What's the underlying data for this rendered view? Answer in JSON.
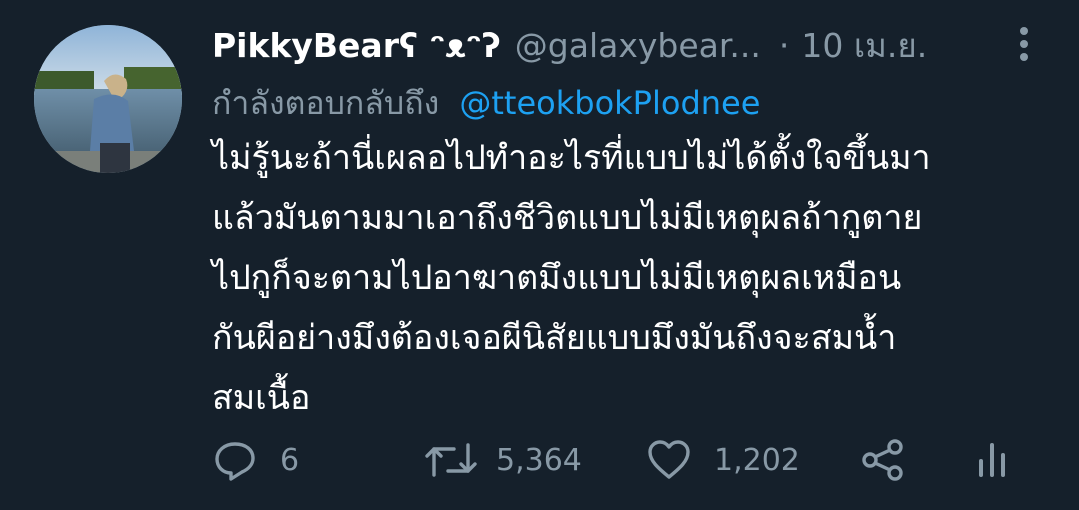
{
  "tweet": {
    "display_name": "PikkyBearʕ ᵔᴥᵔʔ",
    "handle": "@galaxybear...",
    "separator": "·",
    "time": "10 เม.ย.",
    "reply_prefix": "กำลังตอบกลับถึง",
    "reply_mention": "@tteokbokPlodnee",
    "body_lines": [
      "ไม่รู้นะถ้านี่เผลอไปทำอะไรที่แบบไม่ได้ตั้งใจขึ้นมา",
      "แล้วมันตามมาเอาถึงชีวิตแบบไม่มีเหตุผลถ้ากูตาย",
      "ไปกูก็จะตามไปอาฆาตมึงแบบไม่มีเหตุผลเหมือน",
      "กันผีอย่างมึงต้องเจอผีนิสัยแบบมึงมันถึงจะสมน้ำ",
      "สมเนื้อ"
    ],
    "actions": {
      "reply_count": "6",
      "retweet_count": "5,364",
      "like_count": "1,202"
    }
  },
  "icons": {
    "more": "more-vertical-icon",
    "reply": "reply-icon",
    "retweet": "retweet-icon",
    "like": "heart-icon",
    "share": "share-icon",
    "analytics": "analytics-icon"
  },
  "colors": {
    "background": "#15202b",
    "text": "#ffffff",
    "secondary": "#8899a6",
    "mention": "#1da1f2"
  }
}
